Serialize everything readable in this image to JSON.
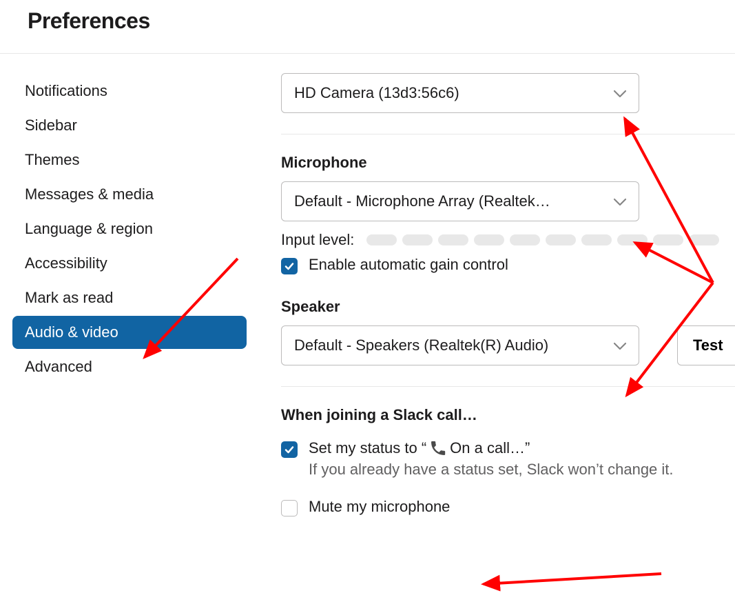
{
  "header": {
    "title": "Preferences"
  },
  "sidebar": {
    "items": [
      {
        "label": "Notifications",
        "active": false
      },
      {
        "label": "Sidebar",
        "active": false
      },
      {
        "label": "Themes",
        "active": false
      },
      {
        "label": "Messages & media",
        "active": false
      },
      {
        "label": "Language & region",
        "active": false
      },
      {
        "label": "Accessibility",
        "active": false
      },
      {
        "label": "Mark as read",
        "active": false
      },
      {
        "label": "Audio & video",
        "active": true
      },
      {
        "label": "Advanced",
        "active": false
      }
    ]
  },
  "main": {
    "camera": {
      "value": "HD Camera (13d3:56c6)"
    },
    "microphone": {
      "label": "Microphone",
      "value": "Default - Microphone Array (Realtek…",
      "input_level_label": "Input level:",
      "gain_checked": true,
      "gain_label": "Enable automatic gain control"
    },
    "speaker": {
      "label": "Speaker",
      "value": "Default - Speakers (Realtek(R) Audio)",
      "test_label": "Test"
    },
    "call": {
      "heading": "When joining a Slack call…",
      "status_checked": true,
      "status_prefix": "Set my status to “",
      "status_text": "On a call…",
      "status_suffix": "”",
      "status_hint": "If you already have a status set, Slack won’t change it.",
      "mute_checked": false,
      "mute_label": "Mute my microphone"
    }
  },
  "annotation_color": "#ff0000"
}
